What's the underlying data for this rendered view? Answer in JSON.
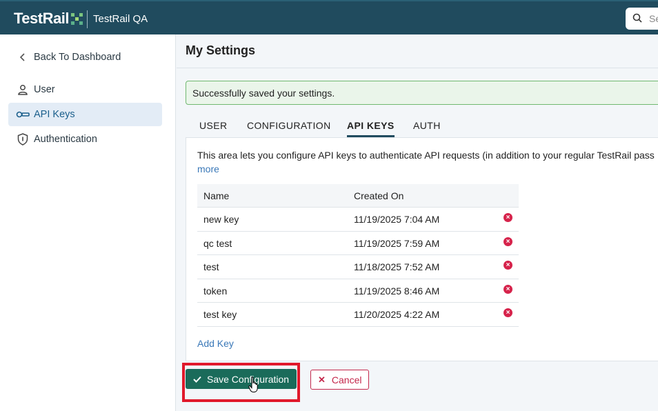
{
  "app": {
    "logo": "TestRail",
    "project": "TestRail QA",
    "search_placeholder": "Search"
  },
  "sidebar": {
    "back_label": "Back To Dashboard",
    "items": [
      {
        "label": "User",
        "icon": "user-icon"
      },
      {
        "label": "API Keys",
        "icon": "key-icon",
        "active": true
      },
      {
        "label": "Authentication",
        "icon": "shield-icon"
      }
    ]
  },
  "main": {
    "title": "My Settings",
    "alert": "Successfully saved your settings.",
    "tabs": [
      "USER",
      "CONFIGURATION",
      "API KEYS",
      "AUTH"
    ],
    "active_tab": "API KEYS",
    "description": "This area lets you configure API keys to authenticate API requests (in addition to your regular TestRail pass",
    "more_link": "more",
    "table": {
      "headers": [
        "Name",
        "Created On"
      ],
      "rows": [
        {
          "name": "new key",
          "created": "11/19/2025 7:04 AM"
        },
        {
          "name": "qc test",
          "created": "11/19/2025 7:59 AM"
        },
        {
          "name": "test",
          "created": "11/18/2025 7:52 AM"
        },
        {
          "name": "token",
          "created": "11/19/2025 8:46 AM"
        },
        {
          "name": "test key",
          "created": "11/20/2025 4:22 AM"
        }
      ]
    },
    "add_key": "Add Key",
    "save_label": "Save Configuration",
    "cancel_label": "Cancel"
  },
  "colors": {
    "topbar": "#204b5e",
    "primary": "#1a6b5a",
    "danger": "#c4264a",
    "highlight": "#e0192b",
    "link": "#3a78b8"
  }
}
